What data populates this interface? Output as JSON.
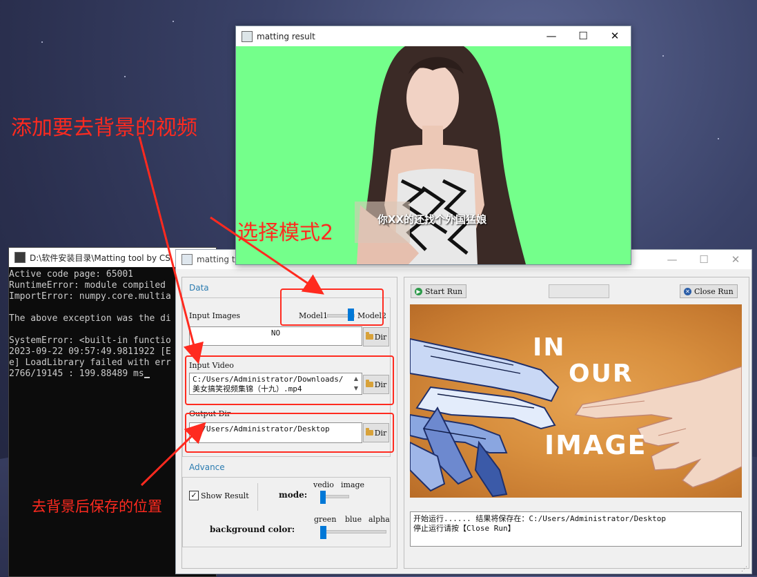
{
  "console": {
    "title": "D:\\软件安装目录\\Matting tool by CS",
    "lines": [
      "Active code page: 65001",
      "RuntimeError: module compiled",
      "ImportError: numpy.core.multia",
      "",
      "The above exception was the di",
      "",
      "SystemError: <built-in functio",
      "2023-09-22 09:57:49.9811922 [E",
      "e] LoadLibrary failed with err",
      "2766/19145 : 199.88489 ms"
    ]
  },
  "main_window": {
    "title": "matting to",
    "data_group": {
      "label": "Data",
      "input_images_label": "Input Images",
      "model_left": "Model1",
      "model_right": "Model2",
      "input_images_value": "NO",
      "dir_label": "Dir",
      "input_video_label": "Input Video",
      "input_video_value": "C:/Users/Administrator/Downloads/美女搞笑视频集锦（十九）.mp4",
      "output_dir_label": "Output Dir",
      "output_dir_value": "C:/Users/Administrator/Desktop"
    },
    "advance_group": {
      "label": "Advance",
      "show_result_label": "Show Result",
      "show_result_checked": true,
      "mode_label": "mode:",
      "mode_left": "vedio",
      "mode_right": "image",
      "bg_color_label": "background color:",
      "bg_opt1": "green",
      "bg_opt2": "blue",
      "bg_opt3": "alpha"
    },
    "toolbar": {
      "start_label": "Start Run",
      "close_label": "Close Run"
    },
    "art_words": [
      "IN",
      "OUR",
      "IMAGE"
    ],
    "log_lines": [
      "开始运行...... 结果将保存在：C:/Users/Administrator/Desktop",
      "停止运行请按【Close Run】"
    ]
  },
  "result_window": {
    "title": "matting result",
    "subtitle_caption": "你XX的还找个外国猛娘"
  },
  "annotations": {
    "add_video": "添加要去背景的视频",
    "select_mode": "选择模式2",
    "save_location": "去背景后保存的位置"
  },
  "colors": {
    "annotation_red": "#ff2a1f",
    "matting_green": "#74ff8b",
    "slider_blue": "#0078d7",
    "group_label_blue": "#2a7bb0"
  }
}
